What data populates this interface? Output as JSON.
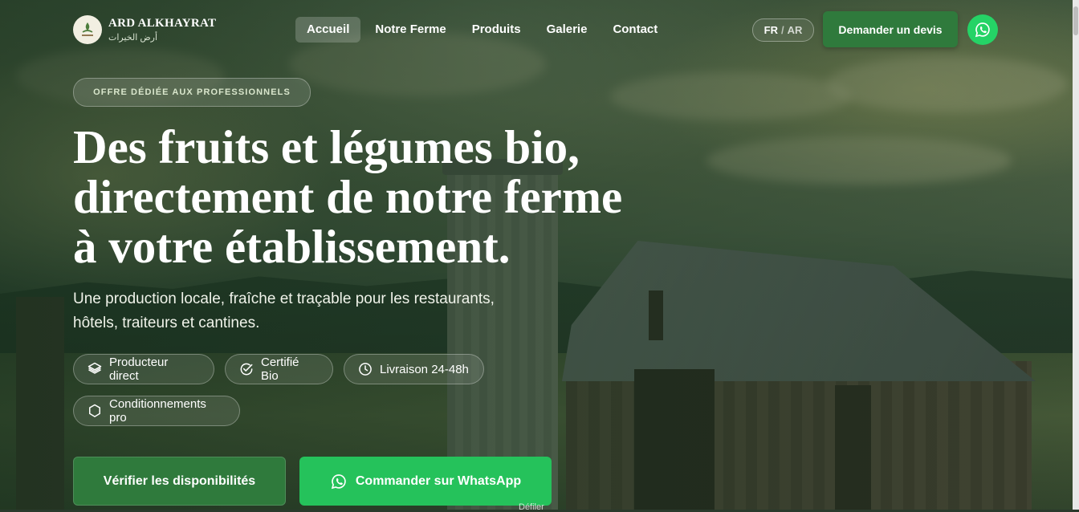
{
  "brand": {
    "name": "ARD ALKHAYRAT",
    "subtitle": "أرض الخيرات"
  },
  "nav": {
    "items": [
      "Accueil",
      "Notre Ferme",
      "Produits",
      "Galerie",
      "Contact"
    ],
    "active": "Accueil"
  },
  "lang": {
    "fr": "FR",
    "separator": "/",
    "ar": "AR",
    "active": "FR"
  },
  "header": {
    "quote_button": "Demander un devis",
    "whatsapp_icon": "whatsapp-icon"
  },
  "hero": {
    "badge": "OFFRE DÉDIÉE AUX PROFESSIONNELS",
    "title_lines": [
      "Des fruits et légumes bio,",
      "directement de notre ferme",
      "à votre établissement."
    ],
    "subtitle_lines": [
      "Une production locale, fraîche et traçable pour les restaurants,",
      "hôtels, traiteurs et cantines."
    ],
    "features": [
      {
        "label": "Producteur direct",
        "icon": "layers-icon"
      },
      {
        "label": "Certifié Bio",
        "icon": "check-badge-icon"
      },
      {
        "label": "Livraison 24-48h",
        "icon": "clock-icon"
      },
      {
        "label": "Conditionnements pro",
        "icon": "hexagon-icon"
      }
    ],
    "cta_primary": "Vérifier les disponibilités",
    "cta_whatsapp": "Commander sur WhatsApp",
    "scroll_hint": "Défiler"
  },
  "colors": {
    "primary_green": "#2f7a3c",
    "whatsapp_green": "#25d366",
    "overlay_green": "#16301c"
  }
}
